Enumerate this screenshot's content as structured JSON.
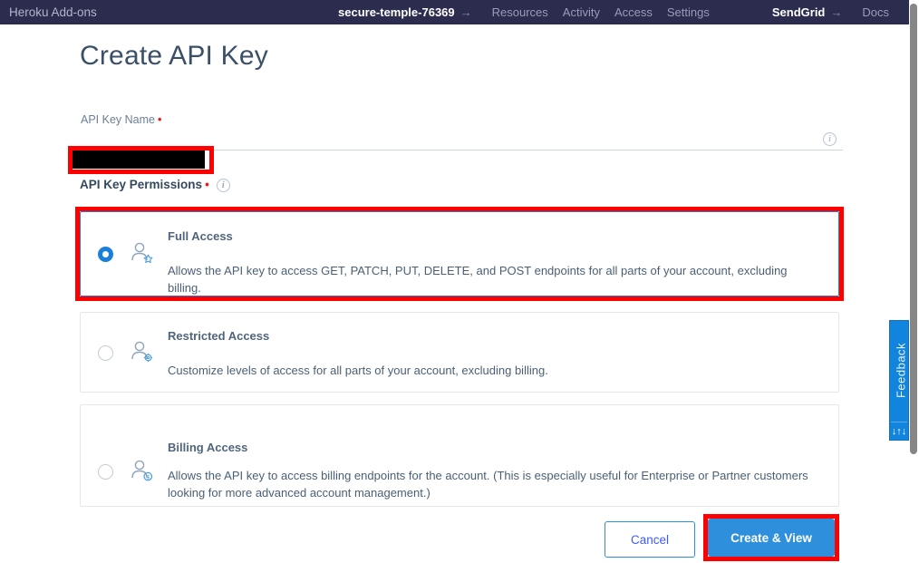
{
  "topbar": {
    "brand": "Heroku Add-ons",
    "app_name": "secure-temple-76369",
    "arrow": "→",
    "nav": [
      {
        "label": "Resources"
      },
      {
        "label": "Activity"
      },
      {
        "label": "Access"
      },
      {
        "label": "Settings"
      }
    ],
    "vendor": "SendGrid",
    "docs": "Docs"
  },
  "page": {
    "title": "Create API Key"
  },
  "form": {
    "name_label": "API Key Name",
    "required_marker": "•",
    "name_value": "",
    "name_info_icon": "i",
    "permissions_label": "API Key Permissions",
    "permissions_required_marker": "•",
    "permissions_info_icon": "i"
  },
  "permissions": [
    {
      "id": "full",
      "title": "Full Access",
      "description": "Allows the API key to access GET, PATCH, PUT, DELETE, and POST endpoints for all parts of your account, excluding billing.",
      "icon": "person-star-icon",
      "selected": true
    },
    {
      "id": "restricted",
      "title": "Restricted Access",
      "description": "Customize levels of access for all parts of your account, excluding billing.",
      "icon": "person-gear-icon",
      "selected": false
    },
    {
      "id": "billing",
      "title": "Billing Access",
      "description": "Allows the API key to access billing endpoints for the account. (This is especially useful for Enterprise or Partner customers looking for more advanced account management.)",
      "icon": "person-dollar-icon",
      "selected": false
    }
  ],
  "actions": {
    "cancel_label": "Cancel",
    "create_label": "Create & View"
  },
  "feedback": {
    "label": "Feedback",
    "arrows_icon": "↓↑↓"
  },
  "colors": {
    "topbar_bg": "#2b2c4e",
    "accent_blue": "#2e8fdc",
    "annotation_red": "#ff0000",
    "required_red": "#e02020",
    "title_slate": "#3b5067"
  }
}
